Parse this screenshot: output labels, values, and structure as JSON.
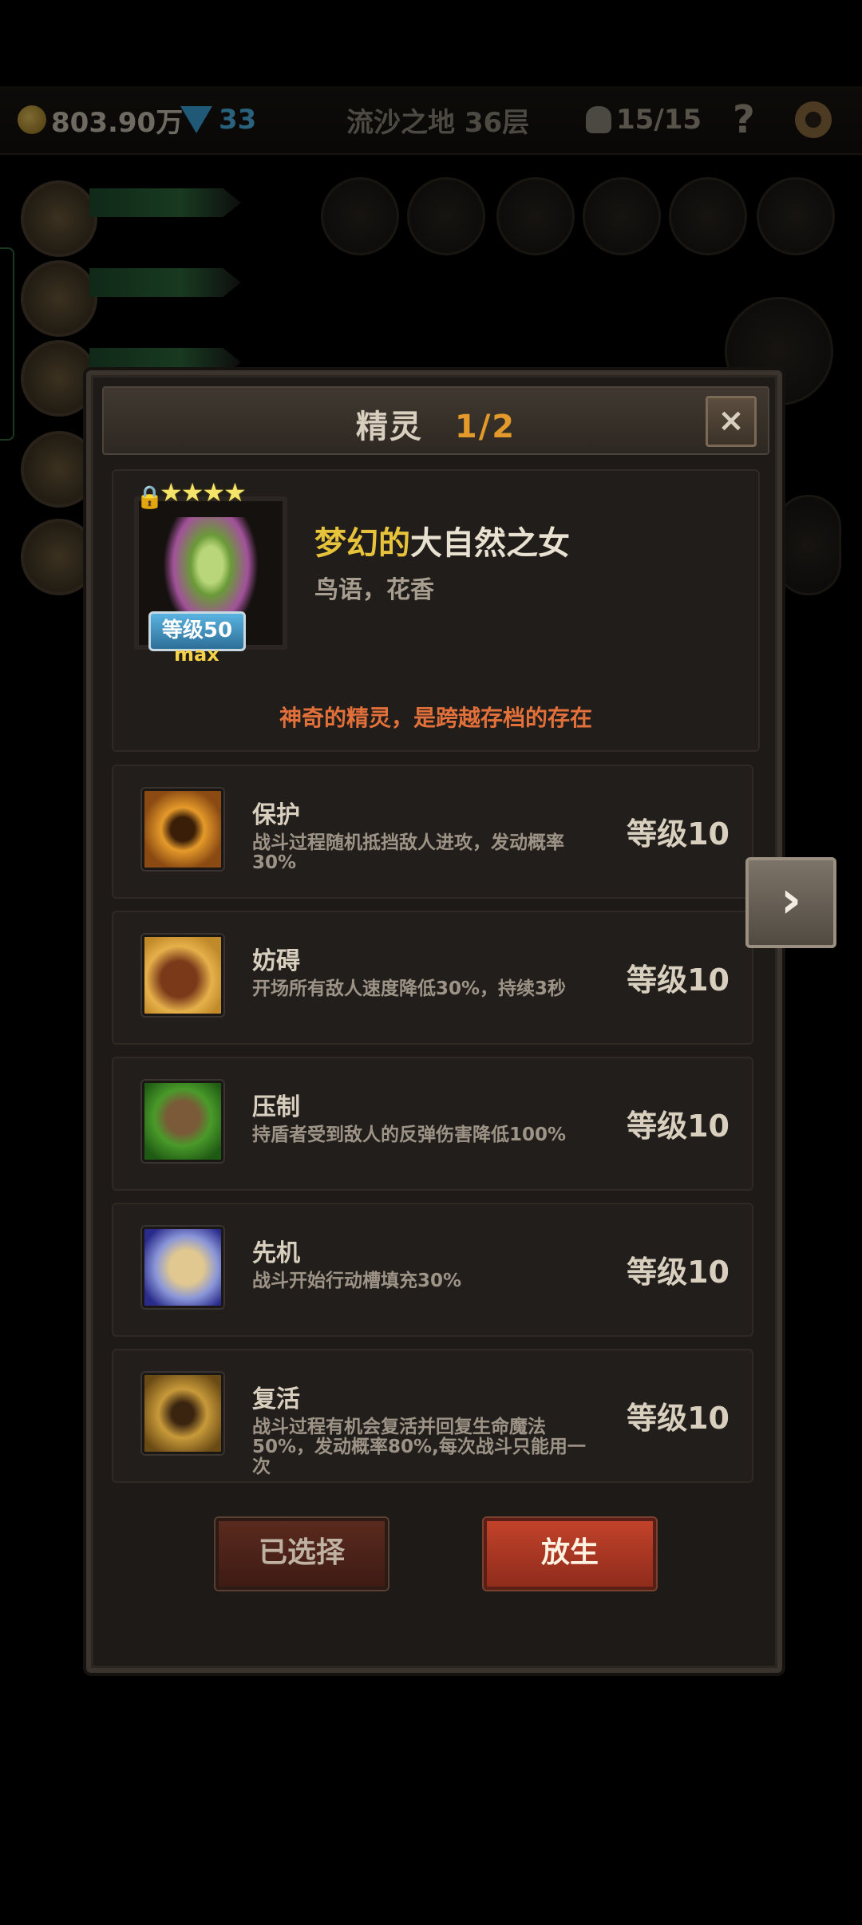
{
  "topbar": {
    "gold": "803.90万",
    "gems": "33",
    "location": "流沙之地 36层",
    "kills": "15/15",
    "help": "?"
  },
  "colors": {
    "accent_orange": "#e39a2a",
    "name_prefix_gold": "#e6c33a",
    "desc_orange": "#e2703a",
    "release_button": "#c2422a"
  },
  "dialog": {
    "title": "精灵",
    "page": "1/2",
    "close_icon": "×"
  },
  "sprite": {
    "stars": "★★★★",
    "level_label": "等级50",
    "max_label": "max",
    "name_prefix": "梦幻的",
    "name_main": "大自然之女",
    "subtitle": "鸟语，花香",
    "description": "神奇的精灵，是跨越存档的存在"
  },
  "skills": [
    {
      "name": "保护",
      "text": "战斗过程随机抵挡敌人进攻，发动概率30%",
      "level": "等级10",
      "icon": "fairy-shield-icon"
    },
    {
      "name": "妨碍",
      "text": "开场所有敌人速度降低30%，持续3秒",
      "level": "等级10",
      "icon": "chained-boot-icon"
    },
    {
      "name": "压制",
      "text": "持盾者受到敌人的反弹伤害降低100%",
      "level": "等级10",
      "icon": "claw-icon"
    },
    {
      "name": "先机",
      "text": "战斗开始行动槽填充30%",
      "level": "等级10",
      "icon": "leopard-icon"
    },
    {
      "name": "复活",
      "text": "战斗过程有机会复活并回复生命魔法50%，发动概率80%,每次战斗只能用一次",
      "level": "等级10",
      "icon": "revive-icon"
    }
  ],
  "buttons": {
    "selected": "已选择",
    "release": "放生",
    "next": "›"
  }
}
